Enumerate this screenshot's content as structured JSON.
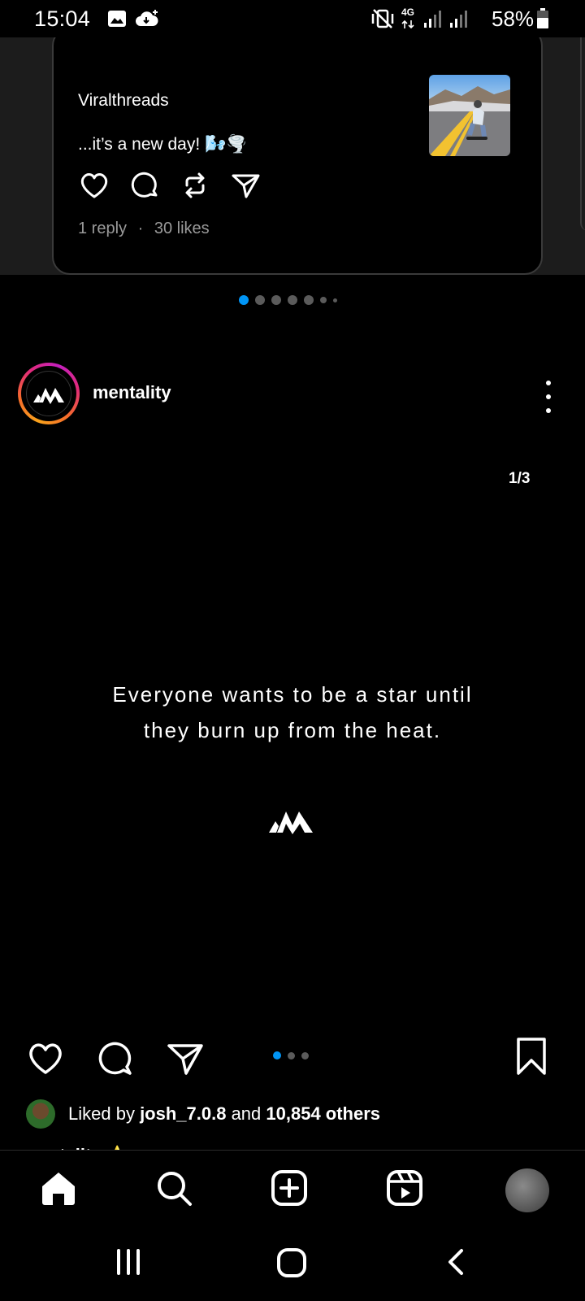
{
  "status_bar": {
    "time": "15:04",
    "network": "4G",
    "battery": "58%"
  },
  "threads_card": {
    "username": "Viralthreads",
    "text": "...it’s a new day! 🌬️🌪️",
    "replies": "1 reply",
    "separator": "·",
    "likes": "30 likes"
  },
  "carousel": {
    "dot_count": 7,
    "active_index": 0,
    "active_color": "#0095f6"
  },
  "post": {
    "username": "mentality",
    "counter": "1/3",
    "quote_line1": "Everyone wants to be a star until",
    "quote_line2": "they burn up from the heat.",
    "liked_prefix": "Liked by ",
    "liked_user": "josh_7.0.8",
    "liked_middle": " and ",
    "liked_count": "10,854 others",
    "caption_peek": "mentality ⭐",
    "image_dots": 3
  },
  "bottom_nav": {
    "items": [
      "home-icon",
      "search-icon",
      "create-icon",
      "reels-icon",
      "profile-avatar"
    ]
  },
  "system_nav": {
    "items": [
      "recent-apps-icon",
      "home-button-icon",
      "back-icon"
    ]
  }
}
